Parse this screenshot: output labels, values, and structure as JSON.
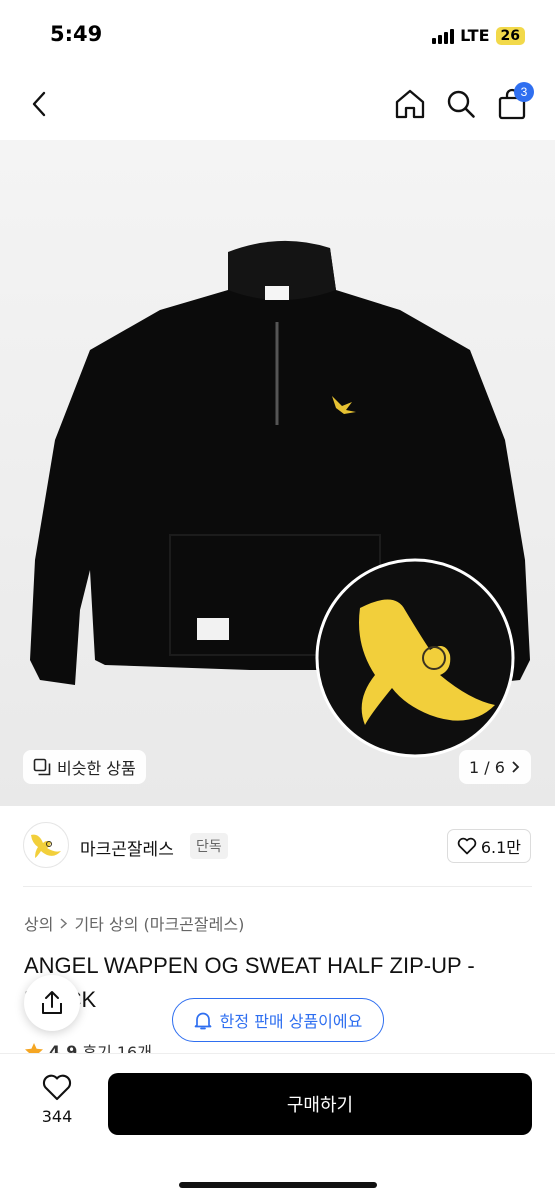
{
  "status": {
    "time": "5:49",
    "network": "LTE",
    "battery": "26"
  },
  "nav": {
    "cart_count": "3"
  },
  "gallery": {
    "similar_label": "비슷한 상품",
    "page_indicator": "1 / 6"
  },
  "seller": {
    "name": "마크곤잘레스",
    "tag": "단독",
    "likes": "6.1만"
  },
  "breadcrumb": {
    "level1": "상의",
    "level2": "기타 상의 (마크곤잘레스)"
  },
  "product": {
    "title_line1": "ANGEL WAPPEN OG SWEAT HALF ZIP-UP -",
    "title_line2": "BLACK",
    "rating": "4.9",
    "review_label": "후기 16개"
  },
  "limited_pill": "한정 판매 상품이에요",
  "bottom": {
    "like_count": "344",
    "buy_label": "구매하기"
  },
  "colors": {
    "accent": "#2f6ff0",
    "buy_button": "#000000",
    "star": "#f5a623",
    "battery": "#f2d94a",
    "logo_yellow": "#f2cf3b"
  },
  "icons": [
    "back-arrow-icon",
    "home-icon",
    "search-icon",
    "bag-icon",
    "similar-icon",
    "chevron-right-icon",
    "heart-icon",
    "share-icon",
    "bell-icon",
    "star-icon",
    "angel-logo-icon"
  ]
}
